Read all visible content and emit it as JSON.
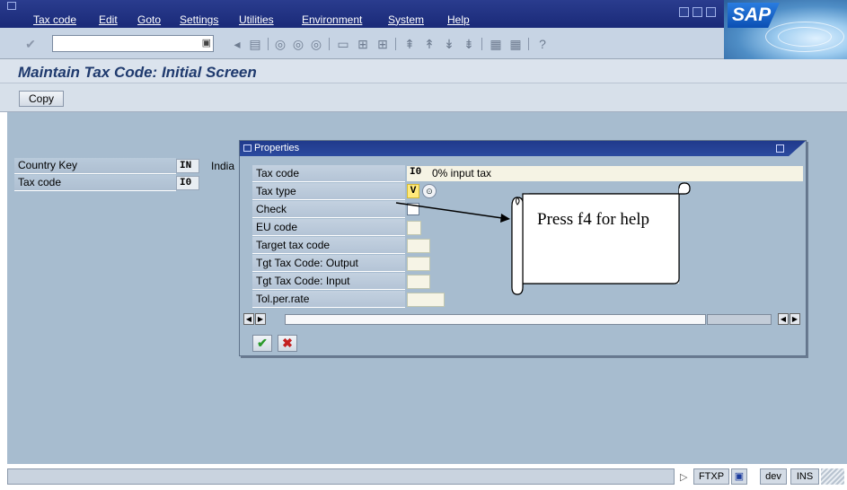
{
  "menu": {
    "items": [
      "Tax code",
      "Edit",
      "Goto",
      "Settings",
      "Utilities",
      "Environment",
      "System",
      "Help"
    ],
    "logo": "SAP"
  },
  "toolbar": {
    "command_field": "",
    "icons": [
      "enter-icon",
      "back-icon",
      "save-icon",
      "back-nav-icon",
      "exit-icon",
      "cancel-icon",
      "print-icon",
      "find-icon",
      "find-next-icon",
      "first-page-icon",
      "previous-page-icon",
      "next-page-icon",
      "last-page-icon",
      "create-session-icon",
      "shortcut-icon",
      "help-icon"
    ]
  },
  "page": {
    "title": "Maintain Tax Code: Initial Screen"
  },
  "app_toolbar": {
    "copy_label": "Copy"
  },
  "selection": {
    "country_key_label": "Country Key",
    "country_key_value": "IN",
    "country_desc": "India",
    "tax_code_label": "Tax code",
    "tax_code_value": "I0"
  },
  "dialog": {
    "title": "Properties",
    "fields": [
      {
        "label": "Tax code",
        "value": "I0",
        "desc": "0% input tax"
      },
      {
        "label": "Tax type",
        "value": "V"
      },
      {
        "label": "Check",
        "value": ""
      },
      {
        "label": "EU code",
        "value": ""
      },
      {
        "label": "Target tax code",
        "value": ""
      },
      {
        "label": "Tgt Tax Code: Output",
        "value": ""
      },
      {
        "label": "Tgt Tax Code: Input",
        "value": ""
      },
      {
        "label": "Tol.per.rate",
        "value": ""
      }
    ]
  },
  "callout": {
    "text": "Press f4 for help"
  },
  "status": {
    "message": "",
    "transaction": "FTXP",
    "system": "dev",
    "mode": "INS"
  }
}
